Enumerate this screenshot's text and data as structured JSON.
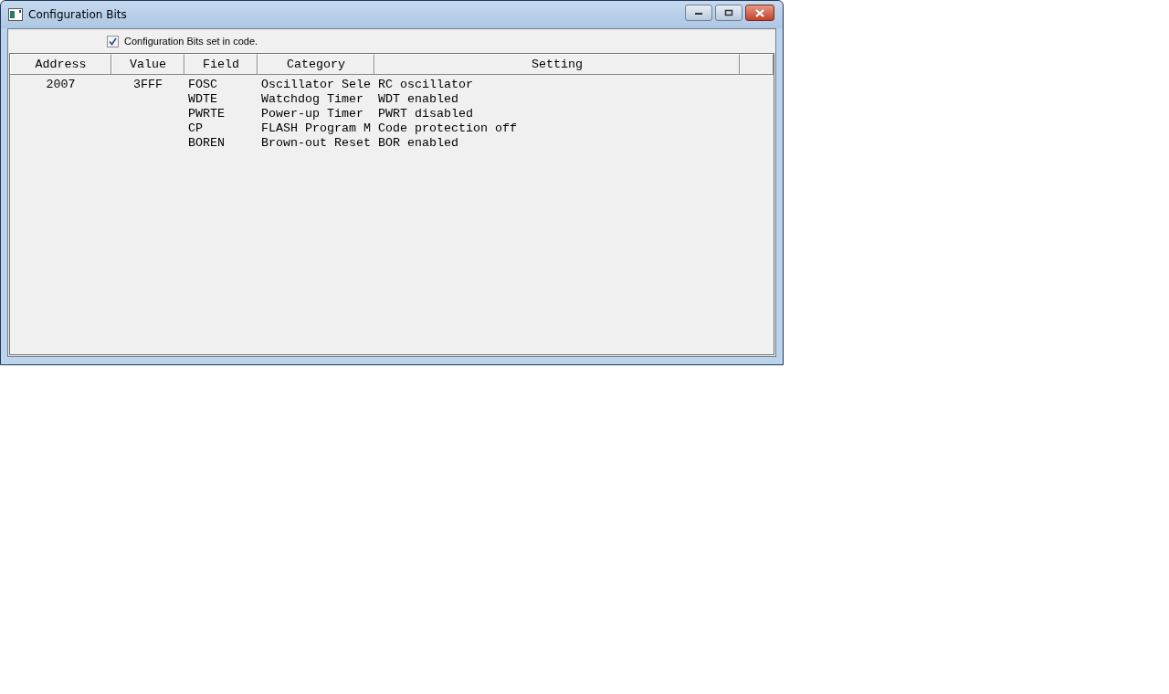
{
  "window": {
    "title": "Configuration Bits"
  },
  "checkbox": {
    "label": "Configuration Bits set in code.",
    "checked": true
  },
  "table": {
    "columns": [
      "Address",
      "Value",
      "Field",
      "Category",
      "Setting"
    ],
    "rows": [
      {
        "address": "2007",
        "value": "3FFF",
        "field": "FOSC",
        "category": "Oscillator Sele",
        "setting": "RC oscillator"
      },
      {
        "field": "WDTE",
        "category": "Watchdog Timer",
        "setting": "WDT enabled"
      },
      {
        "field": "PWRTE",
        "category": "Power-up Timer",
        "setting": "PWRT disabled"
      },
      {
        "field": "CP",
        "category": "FLASH Program M",
        "setting": "Code protection off"
      },
      {
        "field": "BOREN",
        "category": "Brown-out Reset",
        "setting": "BOR enabled"
      }
    ]
  }
}
